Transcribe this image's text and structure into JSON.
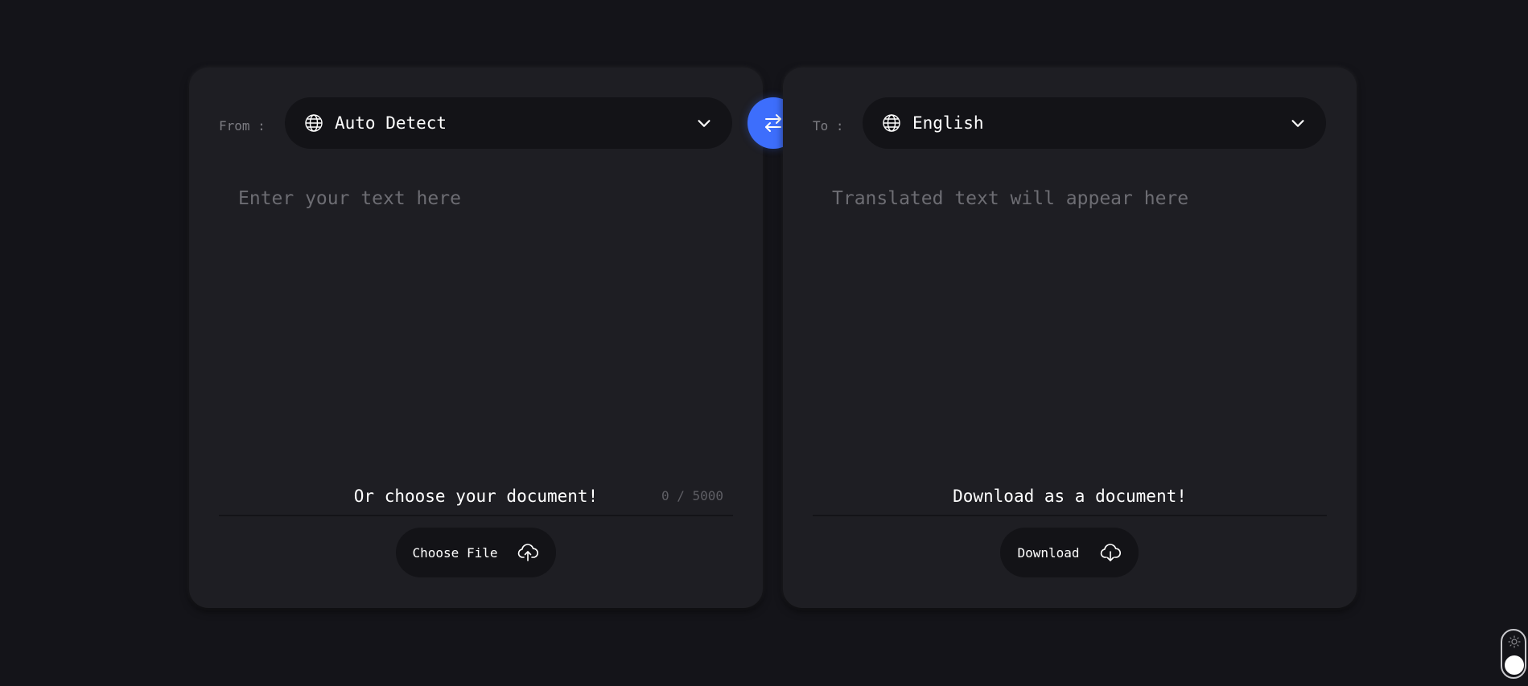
{
  "source": {
    "label": "From :",
    "language": "Auto Detect",
    "placeholder": "Enter your text here",
    "counter": "0 / 5000",
    "doc_title": "Or choose your document!",
    "doc_button_label": "Choose File"
  },
  "target": {
    "label": "To :",
    "language": "English",
    "placeholder": "Translated text will appear here",
    "doc_title": "Download as a document!",
    "doc_button_label": "Download"
  },
  "icons": {
    "language": "globe-icon",
    "dropdown": "chevron-down-icon",
    "swap": "swap-arrows-icon",
    "upload": "cloud-upload-icon",
    "download": "cloud-download-icon",
    "theme": "sun-icon"
  },
  "colors": {
    "background": "#141419",
    "card": "#1e1e23",
    "control": "#131317",
    "accent": "#3d6efc",
    "placeholder": "#6d6d73"
  }
}
